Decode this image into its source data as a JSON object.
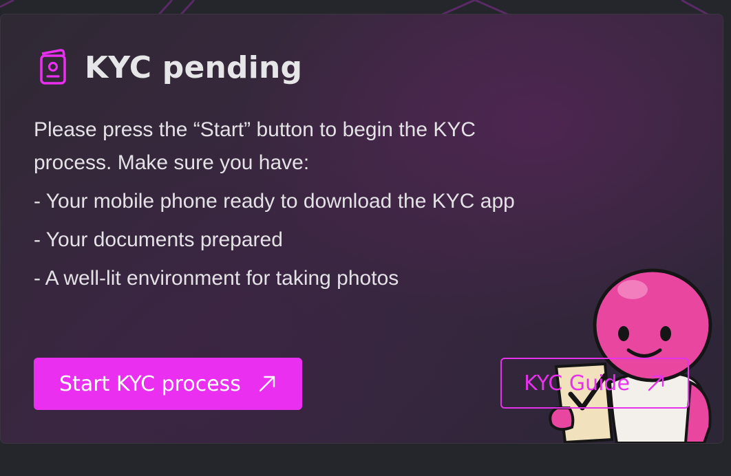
{
  "kyc_card": {
    "title": "KYC pending",
    "icon": "passport-icon",
    "intro": "Please press the “Start” button to begin the KYC process. Make sure you have:",
    "requirements": [
      "- Your mobile phone ready to download the KYC app",
      "- Your documents prepared",
      "- A well-lit environment for taking photos"
    ],
    "start_button": {
      "label": "Start KYC process",
      "icon": "arrow-up-right-icon"
    },
    "guide_button": {
      "label": "KYC Guide",
      "icon": "arrow-up-right-icon"
    },
    "mascot": "mascot-holding-checklist"
  },
  "colors": {
    "page_background": "#24262b",
    "card_background": "#332936",
    "accent": "#ea2ff0",
    "outline_accent": "#e632ea",
    "title_text": "#e6e6e8",
    "body_text": "#e4e2e6",
    "mascot_pink": "#e8469f"
  }
}
